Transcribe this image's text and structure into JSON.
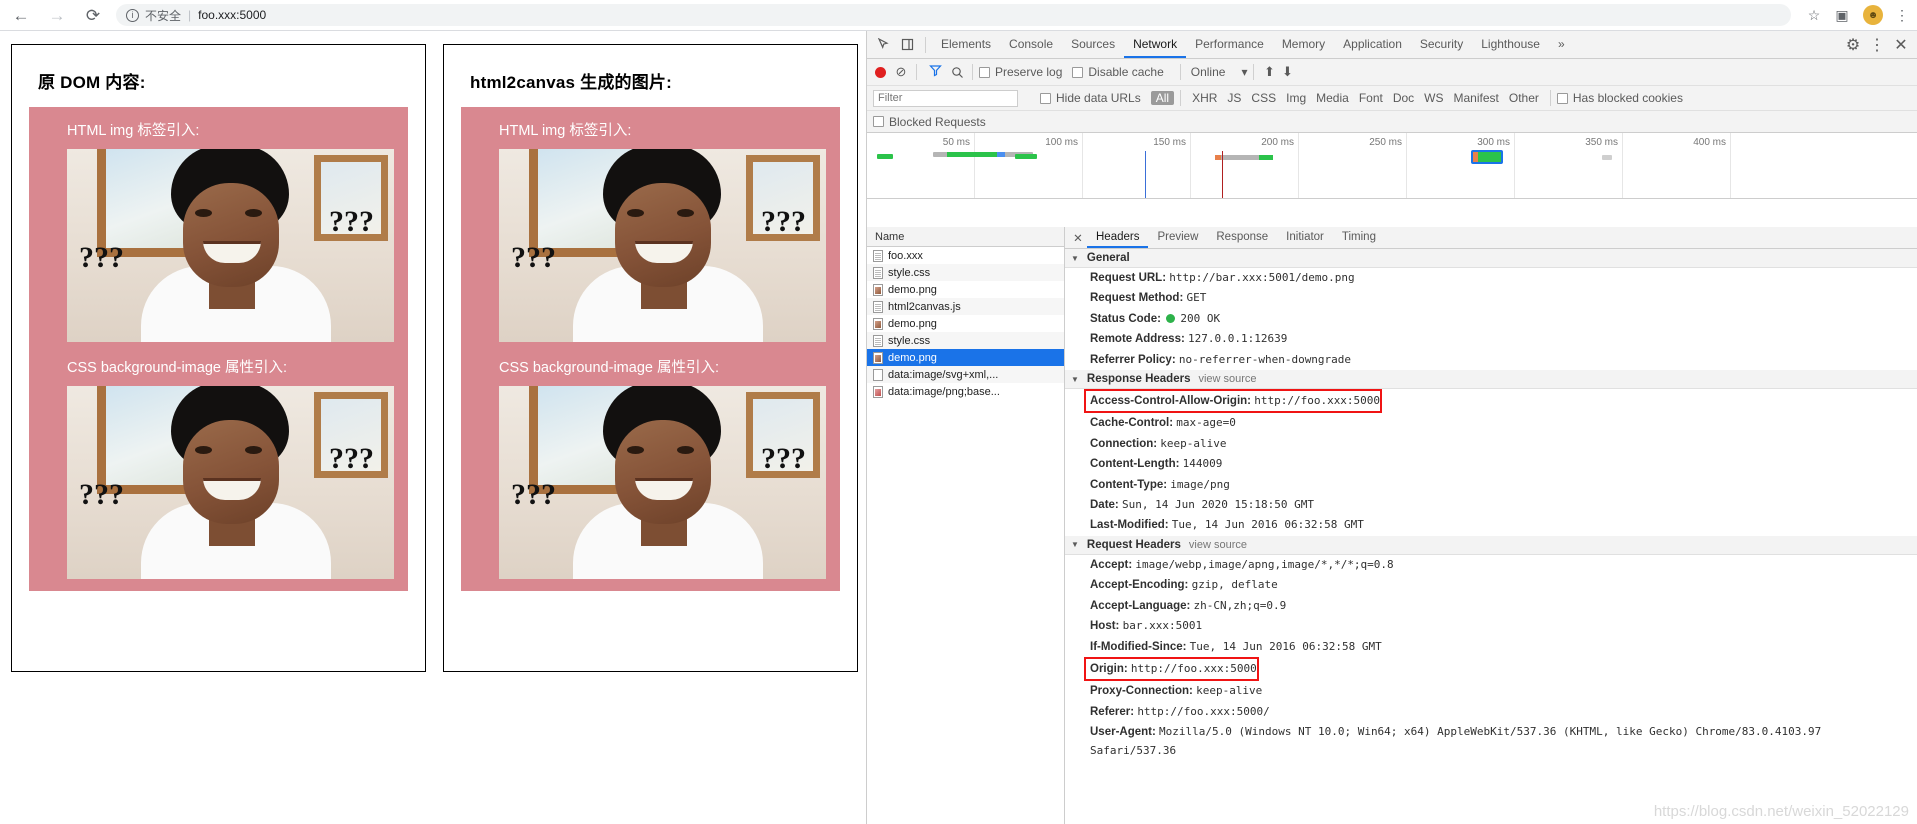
{
  "browser": {
    "back_icon": "←",
    "forward_icon": "→",
    "reload_icon": "⟳",
    "info_icon": "i",
    "security_label": "不安全",
    "url": "foo.xxx:5000",
    "star_icon": "☆",
    "camera_icon": "▣",
    "avatar_icon": "●",
    "menu_icon": "⋮"
  },
  "page": {
    "dom_card": {
      "title": "原 DOM 内容:",
      "sections": [
        {
          "label": "HTML img 标签引入:",
          "q_left": "???",
          "q_right": "???"
        },
        {
          "label": "CSS background-image 属性引入:",
          "q_left": "???",
          "q_right": "???"
        }
      ]
    },
    "canvas_card": {
      "title": "html2canvas 生成的图片:",
      "sections": [
        {
          "label": "HTML img 标签引入:",
          "q_left": "???",
          "q_right": "???"
        },
        {
          "label": "CSS background-image 属性引入:",
          "q_left": "???",
          "q_right": "???"
        }
      ]
    },
    "accent_pink": "#d98890"
  },
  "devtools": {
    "inspect_icon": "⬚",
    "device_icon": "▯",
    "tabs": [
      {
        "label": "Elements",
        "active": false
      },
      {
        "label": "Console",
        "active": false
      },
      {
        "label": "Sources",
        "active": false
      },
      {
        "label": "Network",
        "active": true
      },
      {
        "label": "Performance",
        "active": false
      },
      {
        "label": "Memory",
        "active": false
      },
      {
        "label": "Application",
        "active": false
      },
      {
        "label": "Security",
        "active": false
      },
      {
        "label": "Lighthouse",
        "active": false
      }
    ],
    "more_tabs_icon": "»",
    "settings_icon": "⚙",
    "kebab_icon": "⋮",
    "close_icon": "✕",
    "toolbar": {
      "record_label": "record",
      "clear_icon": "⊘",
      "filter_icon": "▼",
      "search_icon": "⌕",
      "preserve_log": "Preserve log",
      "disable_cache": "Disable cache",
      "throttle_value": "Online",
      "throttle_caret": "▾",
      "import_icon": "⬆",
      "export_icon": "⬇"
    },
    "filterbar": {
      "filter_placeholder": "Filter",
      "hide_data_urls": "Hide data URLs",
      "types": [
        "All",
        "XHR",
        "JS",
        "CSS",
        "Img",
        "Media",
        "Font",
        "Doc",
        "WS",
        "Manifest",
        "Other"
      ],
      "active_type": "All",
      "has_blocked_cookies": "Has blocked cookies",
      "blocked_requests": "Blocked Requests"
    },
    "overview": {
      "ticks": [
        "50 ms",
        "100 ms",
        "150 ms",
        "200 ms",
        "250 ms",
        "300 ms",
        "350 ms",
        "400 ms"
      ]
    },
    "request_list": {
      "column_header": "Name",
      "rows": [
        {
          "name": "foo.xxx",
          "type": "doc",
          "selected": false
        },
        {
          "name": "style.css",
          "type": "doc",
          "selected": false
        },
        {
          "name": "demo.png",
          "type": "img",
          "selected": false
        },
        {
          "name": "html2canvas.js",
          "type": "doc",
          "selected": false
        },
        {
          "name": "demo.png",
          "type": "img",
          "selected": false
        },
        {
          "name": "style.css",
          "type": "doc",
          "selected": false
        },
        {
          "name": "demo.png",
          "type": "img",
          "selected": true
        },
        {
          "name": "data:image/svg+xml,...",
          "type": "blank",
          "selected": false
        },
        {
          "name": "data:image/png;base...",
          "type": "png2",
          "selected": false
        }
      ]
    },
    "detail": {
      "tabs": [
        {
          "label": "Headers",
          "active": true
        },
        {
          "label": "Preview",
          "active": false
        },
        {
          "label": "Response",
          "active": false
        },
        {
          "label": "Initiator",
          "active": false
        },
        {
          "label": "Timing",
          "active": false
        }
      ],
      "general": {
        "title": "General",
        "rows": [
          {
            "name": "Request URL:",
            "value": "http://bar.xxx:5001/demo.png"
          },
          {
            "name": "Request Method:",
            "value": "GET"
          },
          {
            "name": "Status Code:",
            "value": "200 OK",
            "status_dot": true
          },
          {
            "name": "Remote Address:",
            "value": "127.0.0.1:12639"
          },
          {
            "name": "Referrer Policy:",
            "value": "no-referrer-when-downgrade"
          }
        ]
      },
      "response_headers": {
        "title": "Response Headers",
        "view_source": "view source",
        "rows": [
          {
            "name": "Access-Control-Allow-Origin:",
            "value": "http://foo.xxx:5000",
            "highlight": true
          },
          {
            "name": "Cache-Control:",
            "value": "max-age=0"
          },
          {
            "name": "Connection:",
            "value": "keep-alive"
          },
          {
            "name": "Content-Length:",
            "value": "144009"
          },
          {
            "name": "Content-Type:",
            "value": "image/png"
          },
          {
            "name": "Date:",
            "value": "Sun, 14 Jun 2020 15:18:50 GMT"
          },
          {
            "name": "Last-Modified:",
            "value": "Tue, 14 Jun 2016 06:32:58 GMT"
          }
        ]
      },
      "request_headers": {
        "title": "Request Headers",
        "view_source": "view source",
        "rows": [
          {
            "name": "Accept:",
            "value": "image/webp,image/apng,image/*,*/*;q=0.8"
          },
          {
            "name": "Accept-Encoding:",
            "value": "gzip, deflate"
          },
          {
            "name": "Accept-Language:",
            "value": "zh-CN,zh;q=0.9"
          },
          {
            "name": "Host:",
            "value": "bar.xxx:5001"
          },
          {
            "name": "If-Modified-Since:",
            "value": "Tue, 14 Jun 2016 06:32:58 GMT"
          },
          {
            "name": "Origin:",
            "value": "http://foo.xxx:5000",
            "highlight": true
          },
          {
            "name": "Proxy-Connection:",
            "value": "keep-alive"
          },
          {
            "name": "Referer:",
            "value": "http://foo.xxx:5000/"
          },
          {
            "name": "User-Agent:",
            "value": "Mozilla/5.0 (Windows NT 10.0; Win64; x64) AppleWebKit/537.36 (KHTML, like Gecko) Chrome/83.0.4103.97 Safari/537.36"
          }
        ]
      }
    },
    "watermark": "https://blog.csdn.net/weixin_52022129",
    "highlight_color": "#f01414",
    "accent_blue": "#1a73e8"
  }
}
